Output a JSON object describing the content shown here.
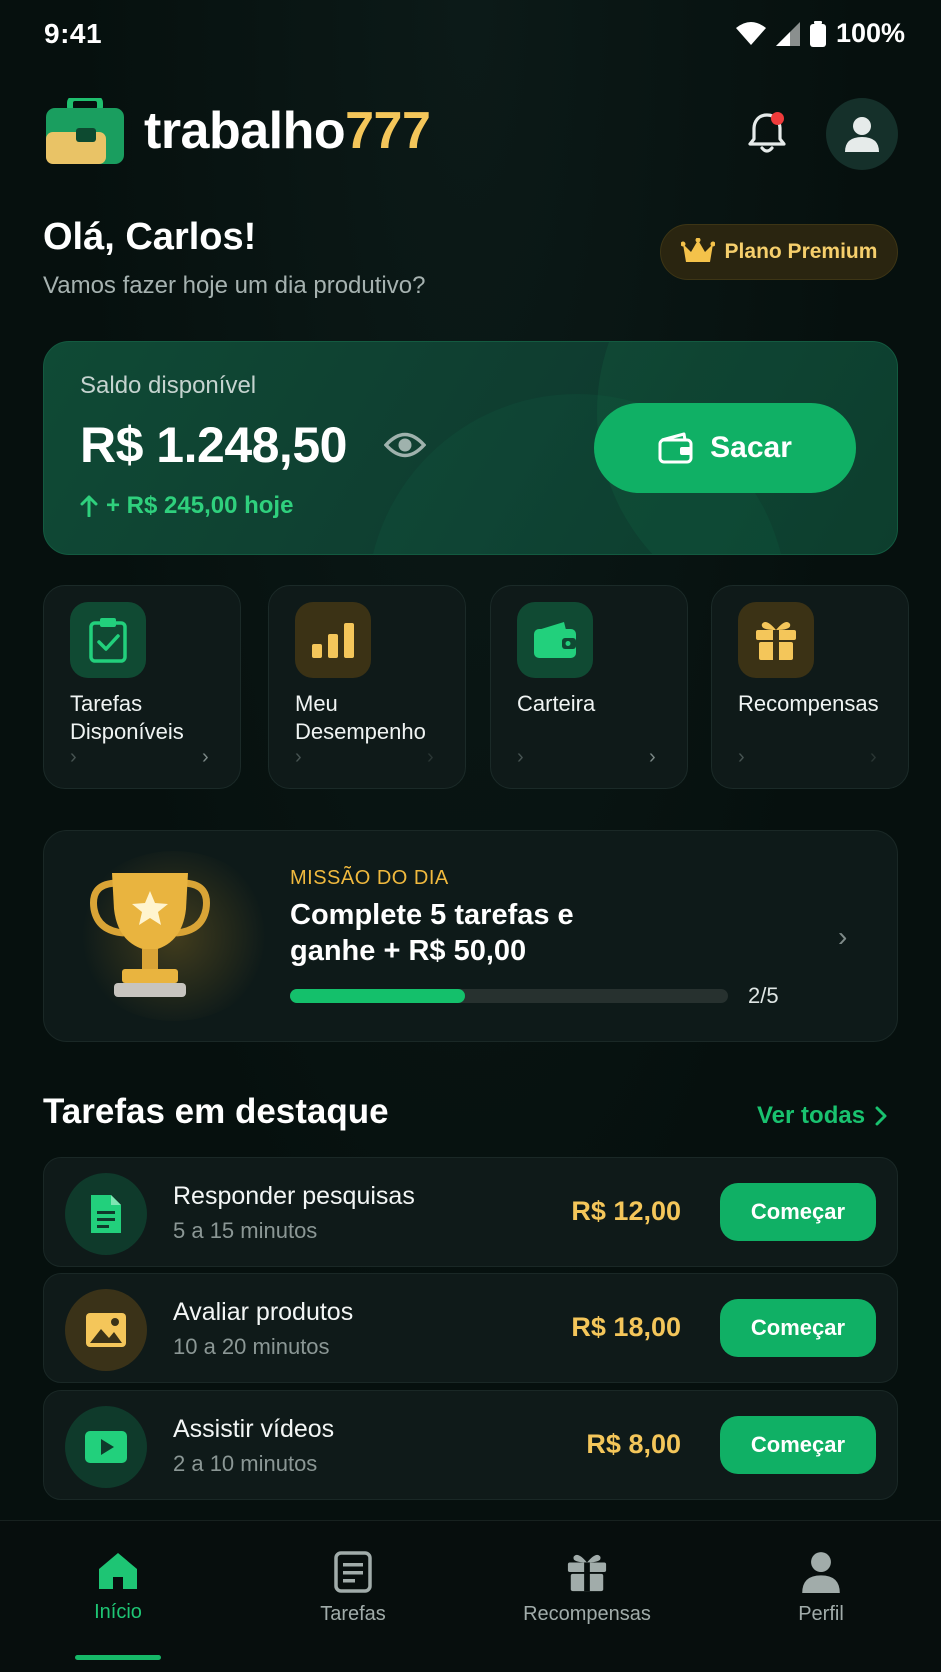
{
  "status_bar": {
    "time": "9:41",
    "battery": "100%"
  },
  "header": {
    "brand_name": "trabalho",
    "brand_accent": "777",
    "notifications_has_dot": true
  },
  "greeting": {
    "title": "Olá, Carlos!",
    "subtitle": "Vamos fazer hoje um dia produtivo?",
    "plan_label": "Plano Premium"
  },
  "balance": {
    "label": "Saldo disponível",
    "value": "R$ 1.248,50",
    "today": "+ R$ 245,00 hoje",
    "withdraw_label": "Sacar"
  },
  "quick_actions": [
    {
      "id": "tarefas",
      "label": "Tarefas Disponíveis",
      "icon": "clipboard-check-icon",
      "tone": "green"
    },
    {
      "id": "desempenho",
      "label": "Meu Desempenho",
      "icon": "bar-chart-icon",
      "tone": "gold"
    },
    {
      "id": "carteira",
      "label": "Carteira",
      "icon": "wallet-icon",
      "tone": "green"
    },
    {
      "id": "recompensas",
      "label": "Recompensas",
      "icon": "gift-icon",
      "tone": "gold"
    }
  ],
  "mission": {
    "tag": "MISSÃO DO DIA",
    "title": "Complete 5 tarefas e ganhe + R$ 50,00",
    "progress_done": 2,
    "progress_total": 5,
    "progress_label": "2/5"
  },
  "featured": {
    "title": "Tarefas em destaque",
    "see_all": "Ver todas",
    "tasks": [
      {
        "name": "Responder pesquisas",
        "duration": "5 a 15 minutos",
        "price": "R$ 12,00",
        "action": "Começar",
        "icon": "document-icon",
        "tone": "green"
      },
      {
        "name": "Avaliar produtos",
        "duration": "10 a 20 minutos",
        "price": "R$ 18,00",
        "action": "Começar",
        "icon": "image-icon",
        "tone": "gold"
      },
      {
        "name": "Assistir vídeos",
        "duration": "2 a 10 minutos",
        "price": "R$ 8,00",
        "action": "Começar",
        "icon": "play-video-icon",
        "tone": "green"
      }
    ]
  },
  "bottom_nav": [
    {
      "label": "Início",
      "icon": "home-icon",
      "active": true
    },
    {
      "label": "Tarefas",
      "icon": "tasks-icon",
      "active": false
    },
    {
      "label": "Recompensas",
      "icon": "gift-icon",
      "active": false
    },
    {
      "label": "Perfil",
      "icon": "user-icon",
      "active": false
    }
  ],
  "colors": {
    "background": "#06100e",
    "accent_green": "#10b065",
    "accent_gold": "#f4c65a",
    "notification_dot": "#ef3b3b"
  }
}
